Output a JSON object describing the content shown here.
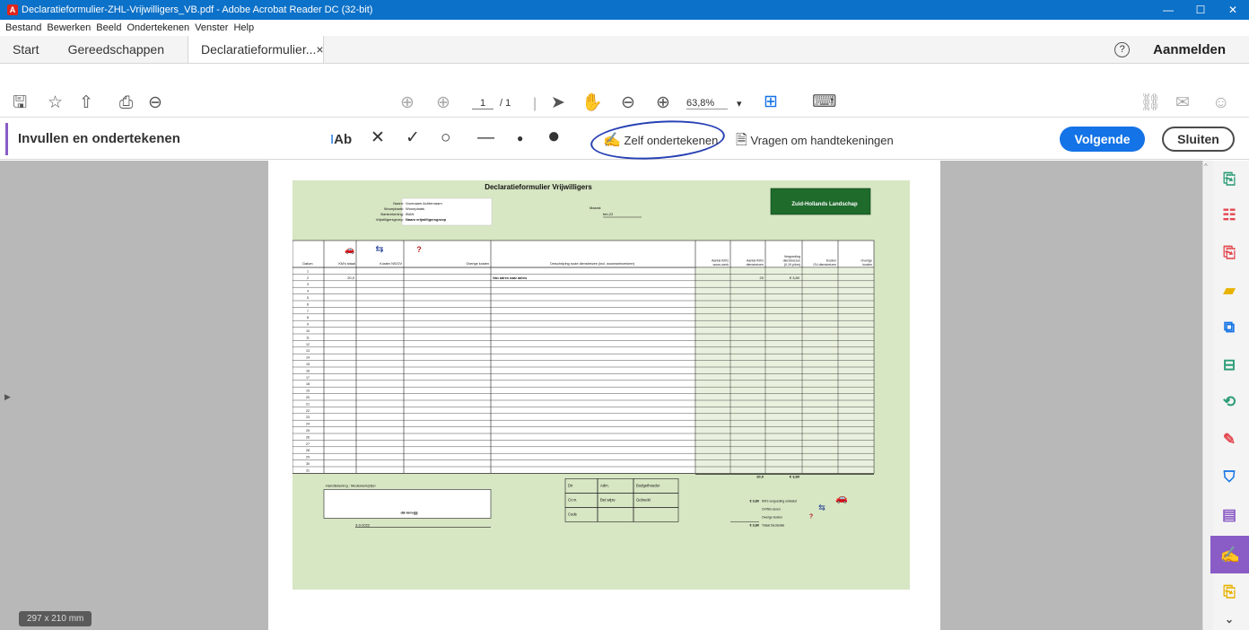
{
  "window": {
    "title": "Declaratieformulier-ZHL-Vrijwilligers_VB.pdf - Adobe Acrobat Reader DC (32-bit)",
    "app_icon_letter": "A",
    "controls": [
      "—",
      "☐",
      "✕"
    ]
  },
  "menu": [
    "Bestand",
    "Bewerken",
    "Beeld",
    "Ondertekenen",
    "Venster",
    "Help"
  ],
  "tabs": {
    "home": "Start",
    "tools": "Gereedschappen",
    "doc": "Declaratieformulier...",
    "close": "×"
  },
  "account": {
    "help": "?",
    "signin": "Aanmelden"
  },
  "toolbar": {
    "page_current": "1",
    "page_total": "/ 1",
    "zoom": "63,8%",
    "zoom_caret": "▾"
  },
  "fillsign": {
    "title": "Invullen en ondertekenen",
    "text_tool": "Ab",
    "sign_self": "Zelf ondertekenen",
    "request": "Vragen om handtekeningen",
    "next": "Volgende",
    "close": "Sluiten"
  },
  "page_size": "297 x 210 mm",
  "form": {
    "title": "Declaratieformulier Vrijwilligers",
    "labels": {
      "name": "Naam:",
      "city": "Woonplaats:",
      "bank": "Bankrekening:",
      "group": "Vrijwilligersgroep:",
      "month": "Maand:"
    },
    "values": {
      "name": "Voornaam Achternaam",
      "city": "Woonplaats",
      "bank": "IBAN",
      "group": "Naam vrijwilligersgroep",
      "month": "feb-22"
    },
    "logo": "Zuid-Hollands Landschap",
    "columns": [
      "Datum",
      "KM's totaal",
      "Kosten NS/OV",
      "Overige kosten",
      "Omschrijving route dienstreizen (incl. woonwerkverkeer)",
      "Aantal KM's woon-werk",
      "Aantal KM's dienstreizen",
      "Vergoeding dienstreizen (0,19 p/km)",
      "Kosten OV-dienstreizen",
      "Overige kosten"
    ],
    "rows": [
      {
        "d": "1",
        "km": "",
        "ov": "",
        "ok": "",
        "desc": "",
        "ww": "",
        "dr": "",
        "verg": "",
        "kov": "",
        "ok2": ""
      },
      {
        "d": "2",
        "km": "20,0",
        "ov": "",
        "ok": "",
        "desc": "Van adres naar adres",
        "ww": "",
        "dr": "20",
        "verg": "€ 3,80",
        "kov": "",
        "ok2": ""
      },
      {
        "d": "3"
      },
      {
        "d": "4"
      },
      {
        "d": "5"
      },
      {
        "d": "6"
      },
      {
        "d": "7"
      },
      {
        "d": "8"
      },
      {
        "d": "9"
      },
      {
        "d": "10"
      },
      {
        "d": "11"
      },
      {
        "d": "12"
      },
      {
        "d": "13"
      },
      {
        "d": "14"
      },
      {
        "d": "15"
      },
      {
        "d": "16"
      },
      {
        "d": "17"
      },
      {
        "d": "18"
      },
      {
        "d": "19"
      },
      {
        "d": "20"
      },
      {
        "d": "21"
      },
      {
        "d": "22"
      },
      {
        "d": "23"
      },
      {
        "d": "24"
      },
      {
        "d": "25"
      },
      {
        "d": "26"
      },
      {
        "d": "27"
      },
      {
        "d": "28"
      },
      {
        "d": "29"
      },
      {
        "d": "30"
      },
      {
        "d": "31"
      }
    ],
    "totals": {
      "km": "20,0",
      "verg": "€ 3,80"
    },
    "signature": {
      "label": "Handtekening : Medewerk(st)er",
      "date_placeholder": "dd-mm-jjjj",
      "date": "3-3-2022"
    },
    "admin": [
      [
        "Dir",
        "Adm.",
        "Budgethouder"
      ],
      [
        "Cr.nr.",
        "Bet.wijze",
        "Geboekt"
      ],
      [
        "Code",
        "",
        ""
      ]
    ],
    "summary": [
      {
        "amount": "€ 3,80",
        "label": "KM's vergoeding onbelast"
      },
      {
        "amount": "",
        "label": "OV/NS reizen"
      },
      {
        "amount": "",
        "label": "Overige kosten"
      },
      {
        "amount": "€ 3,80",
        "label": "Totaal Declaratie"
      }
    ]
  },
  "colors": {
    "titlebar": "#0c71c8",
    "accent_purple": "#8a5cc6",
    "next_button": "#1473e6",
    "sheet": "#d7e6c3",
    "logo_bg": "#1e6b2c"
  }
}
